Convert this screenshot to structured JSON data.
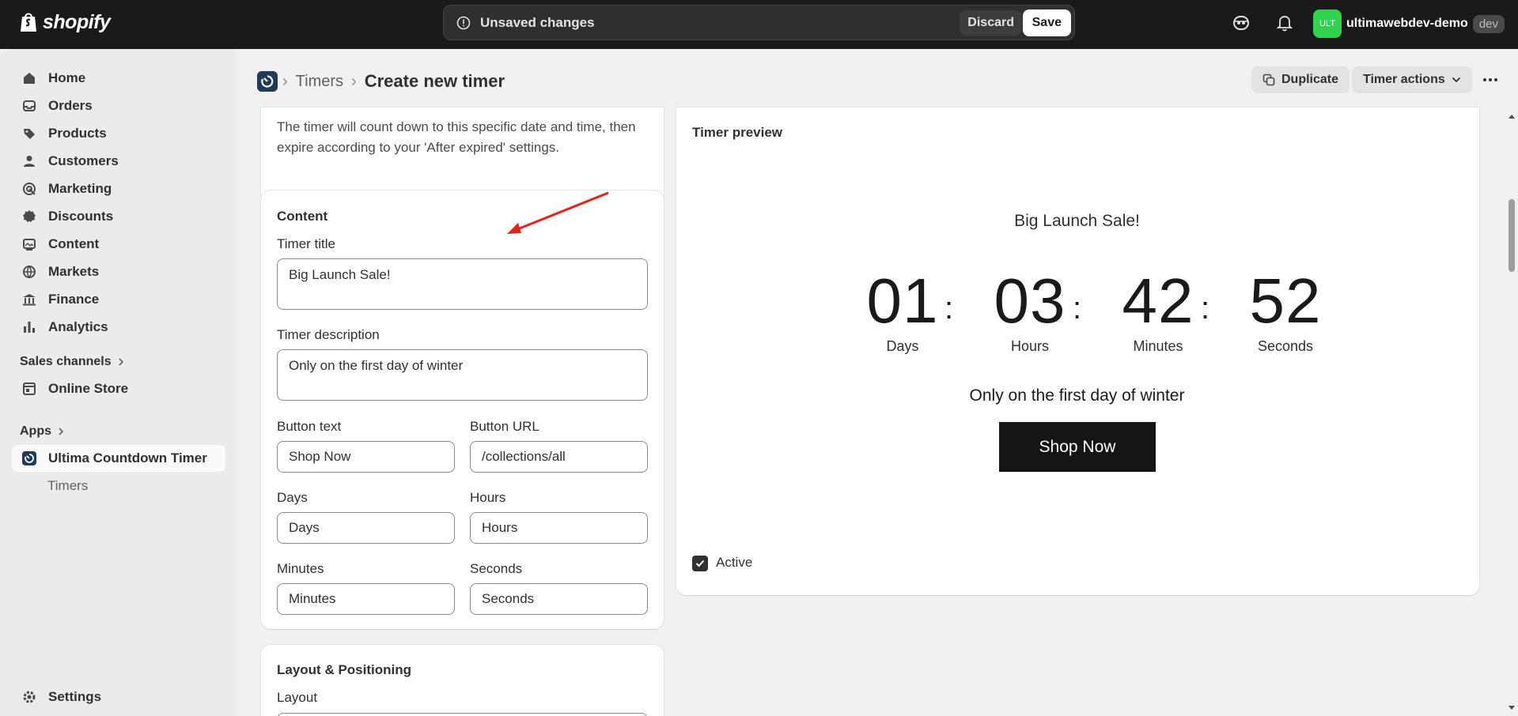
{
  "topbar": {
    "logo_text": "shopify",
    "unsaved_text": "Unsaved changes",
    "discard_label": "Discard",
    "save_label": "Save",
    "store_initials": "ULT",
    "store_name": "ultimawebdev-demo",
    "store_badge": "dev"
  },
  "sidebar": {
    "items": [
      {
        "label": "Home",
        "icon": "home-icon"
      },
      {
        "label": "Orders",
        "icon": "inbox-icon"
      },
      {
        "label": "Products",
        "icon": "tag-icon"
      },
      {
        "label": "Customers",
        "icon": "person-icon"
      },
      {
        "label": "Marketing",
        "icon": "target-icon"
      },
      {
        "label": "Discounts",
        "icon": "discount-icon"
      },
      {
        "label": "Content",
        "icon": "image-icon"
      },
      {
        "label": "Markets",
        "icon": "globe-icon"
      },
      {
        "label": "Finance",
        "icon": "bank-icon"
      },
      {
        "label": "Analytics",
        "icon": "bar-chart-icon"
      }
    ],
    "sales_channels_label": "Sales channels",
    "online_store_label": "Online Store",
    "apps_label": "Apps",
    "app_label": "Ultima Countdown Timer",
    "app_sub_label": "Timers",
    "settings_label": "Settings"
  },
  "header": {
    "breadcrumb_link": "Timers",
    "title": "Create new timer",
    "duplicate_label": "Duplicate",
    "timer_actions_label": "Timer actions"
  },
  "schedule_card": {
    "text": "The timer will count down to this specific date and time, then expire according to your 'After expired' settings."
  },
  "content_card": {
    "heading": "Content",
    "timer_title_label": "Timer title",
    "timer_title_value": "Big Launch Sale!",
    "timer_description_label": "Timer description",
    "timer_description_value": "Only on the first day of winter",
    "button_text_label": "Button text",
    "button_text_value": "Shop Now",
    "button_url_label": "Button URL",
    "button_url_value": "/collections/all",
    "days_label": "Days",
    "days_value": "Days",
    "hours_label": "Hours",
    "hours_value": "Hours",
    "minutes_label": "Minutes",
    "minutes_value": "Minutes",
    "seconds_label": "Seconds",
    "seconds_value": "Seconds"
  },
  "layout_card": {
    "heading": "Layout & Positioning",
    "layout_label": "Layout"
  },
  "preview": {
    "heading": "Timer preview",
    "title": "Big Launch Sale!",
    "units": [
      {
        "value": "01",
        "label": "Days"
      },
      {
        "value": "03",
        "label": "Hours"
      },
      {
        "value": "42",
        "label": "Minutes"
      },
      {
        "value": "52",
        "label": "Seconds"
      }
    ],
    "separator": ":",
    "description": "Only on the first day of winter",
    "button_label": "Shop Now",
    "active_label": "Active",
    "active_checked": true
  },
  "colors": {
    "topbar_bg": "#1a1a1a",
    "store_avatar": "#32d34c",
    "annotation_arrow": "#e3241b",
    "preview_button_bg": "#151515"
  }
}
